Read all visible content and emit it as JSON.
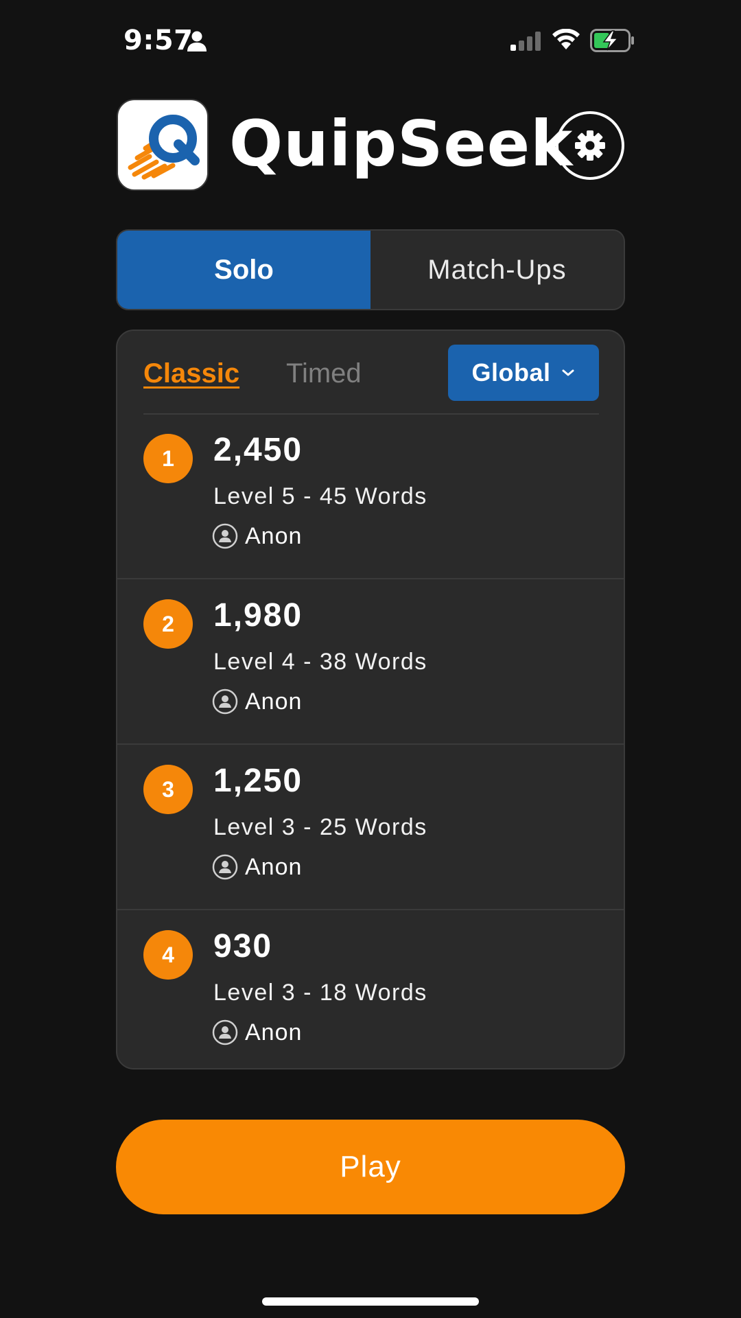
{
  "status_bar": {
    "time": "9:57",
    "icons": [
      "person-icon",
      "cellular-signal-icon",
      "wifi-icon",
      "battery-charging-icon"
    ]
  },
  "header": {
    "app_title": "QuipSeek",
    "logo_letter": "Q",
    "settings_icon": "gear-icon"
  },
  "mode_tabs": [
    {
      "label": "Solo",
      "active": true
    },
    {
      "label": "Match-Ups",
      "active": false
    }
  ],
  "leaderboard": {
    "type_tabs": [
      {
        "label": "Classic",
        "active": true
      },
      {
        "label": "Timed",
        "active": false
      }
    ],
    "scope": {
      "selected": "Global",
      "icon": "chevron-down-icon"
    },
    "entries": [
      {
        "rank": "1",
        "score": "2,450",
        "detail": "Level 5 - 45 Words",
        "player": "Anon"
      },
      {
        "rank": "2",
        "score": "1,980",
        "detail": "Level 4 - 38 Words",
        "player": "Anon"
      },
      {
        "rank": "3",
        "score": "1,250",
        "detail": "Level 3 - 25 Words",
        "player": "Anon"
      },
      {
        "rank": "4",
        "score": "930",
        "detail": "Level 3 - 18 Words",
        "player": "Anon"
      }
    ]
  },
  "actions": {
    "play_label": "Play"
  },
  "colors": {
    "background": "#121212",
    "card": "#2a2a2a",
    "accent_blue": "#1b63ae",
    "accent_orange": "#f98904",
    "battery_green": "#34c759"
  }
}
